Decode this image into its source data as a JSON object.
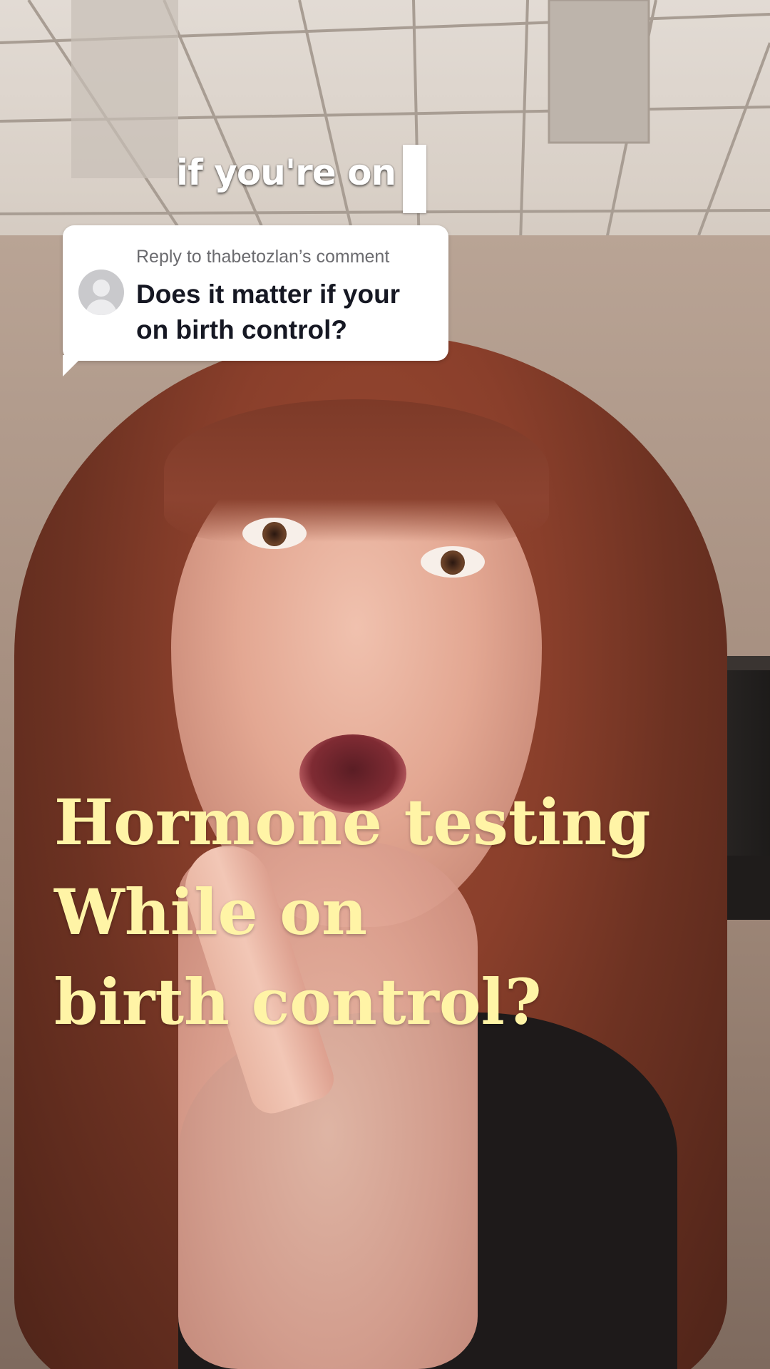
{
  "caption": {
    "text": "if you're on"
  },
  "reply": {
    "label": "Reply to thabetozlan’s comment",
    "question": "Does it matter if your on birth control?",
    "avatar_icon": "default-user-avatar-icon"
  },
  "headline": {
    "lines": [
      "Hormone testing",
      "While on",
      "birth control?"
    ],
    "color": "#fff4a6"
  },
  "colors": {
    "card_background": "#ffffff",
    "question_text": "#161823",
    "label_text": "#6b6b6f"
  }
}
